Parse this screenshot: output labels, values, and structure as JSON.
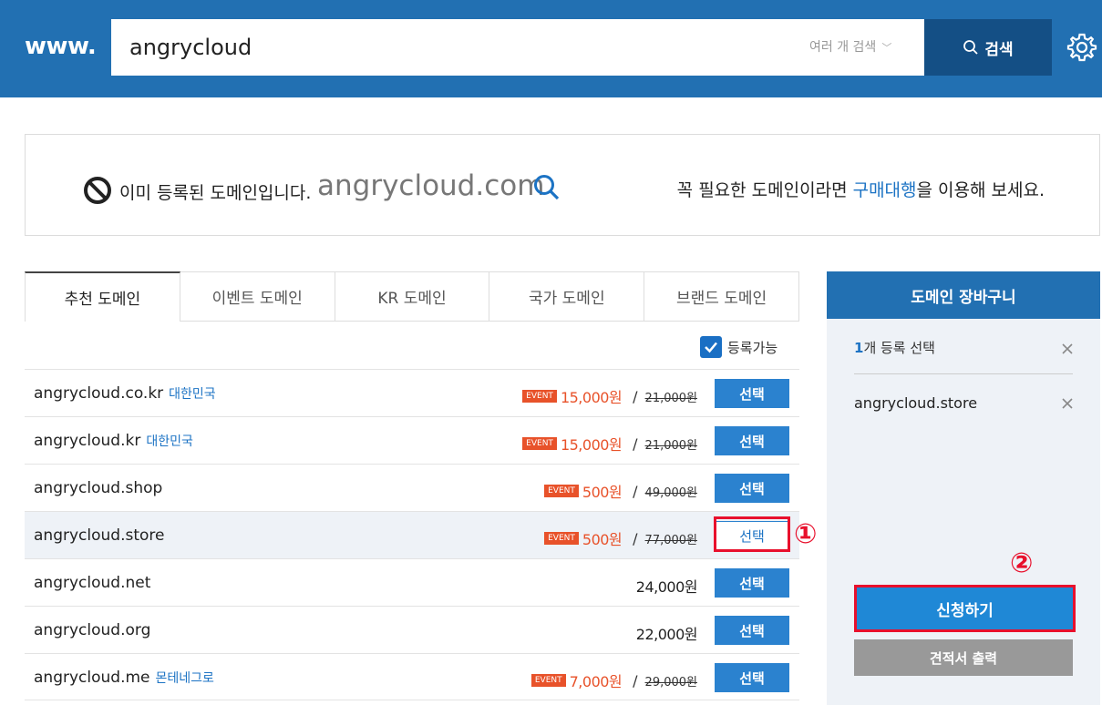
{
  "header": {
    "logo": "www.",
    "search_value": "angrycloud",
    "multi_search_label": "여러 개 검색",
    "search_button": "검색"
  },
  "notice": {
    "message": "이미 등록된 도메인입니다.",
    "domain": "angrycloud.com",
    "right_prefix": "꼭 필요한 도메인이라면 ",
    "right_link": "구매대행",
    "right_suffix": "을 이용해 보세요."
  },
  "tabs": [
    "추천 도메인",
    "이벤트 도메인",
    "KR 도메인",
    "국가 도메인",
    "브랜드 도메인"
  ],
  "filter": {
    "label": "등록가능",
    "checked": true
  },
  "domains": [
    {
      "name": "angrycloud.co.kr",
      "country": "대한민국",
      "event": "EVENT",
      "price": "15,000원",
      "original": "21,000원",
      "button": "선택"
    },
    {
      "name": "angrycloud.kr",
      "country": "대한민국",
      "event": "EVENT",
      "price": "15,000원",
      "original": "21,000원",
      "button": "선택"
    },
    {
      "name": "angrycloud.shop",
      "country": "",
      "event": "EVENT",
      "price": "500원",
      "original": "49,000원",
      "button": "선택"
    },
    {
      "name": "angrycloud.store",
      "country": "",
      "event": "EVENT",
      "price": "500원",
      "original": "77,000원",
      "button": "선택"
    },
    {
      "name": "angrycloud.net",
      "country": "",
      "event": "",
      "price": "24,000원",
      "original": "",
      "button": "선택"
    },
    {
      "name": "angrycloud.org",
      "country": "",
      "event": "",
      "price": "22,000원",
      "original": "",
      "button": "선택"
    },
    {
      "name": "angrycloud.me",
      "country": "몬테네그로",
      "event": "EVENT",
      "price": "7,000원",
      "original": "29,000원",
      "button": "선택"
    }
  ],
  "cart": {
    "title": "도메인 장바구니",
    "count": "1",
    "count_suffix": "개 등록 선택",
    "item": "angrycloud.store",
    "apply_button": "신청하기",
    "quote_button": "견적서 출력"
  },
  "annotations": {
    "one": "①",
    "two": "②"
  },
  "colors": {
    "header": "#2270b2",
    "accent": "#1c73c4",
    "event": "#e8522a",
    "highlight": "#e8102c"
  }
}
